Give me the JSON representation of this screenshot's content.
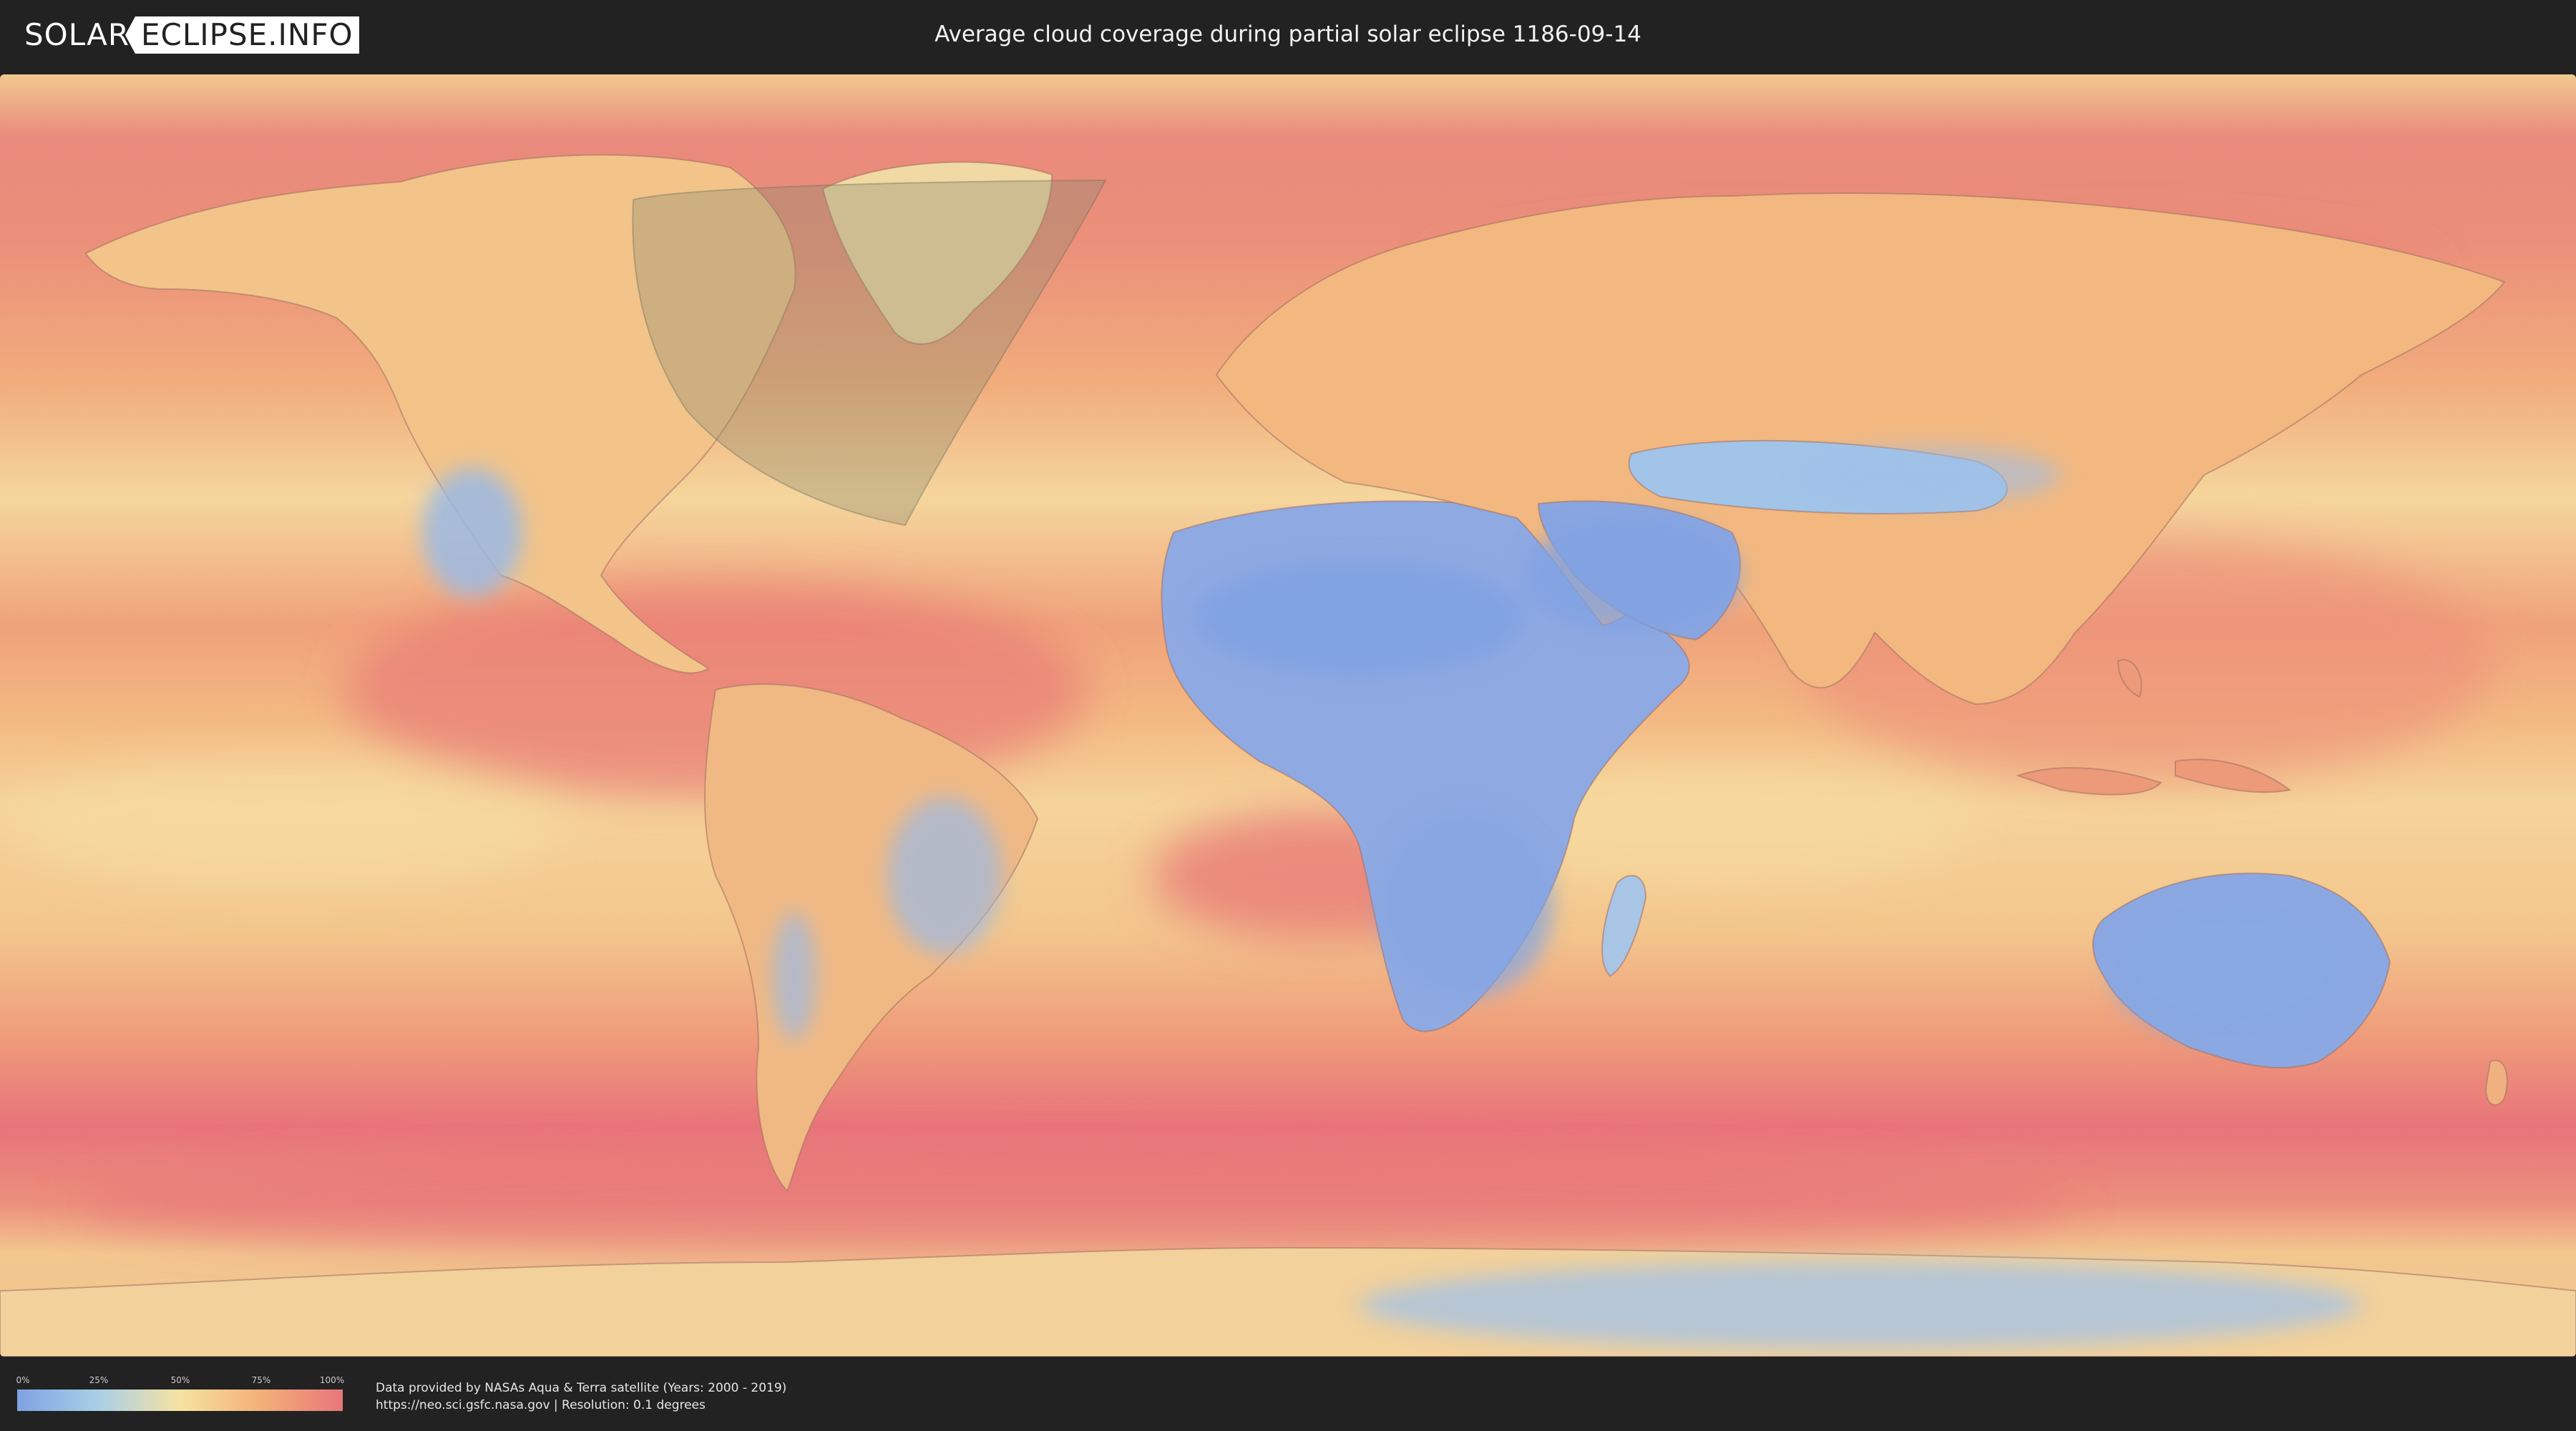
{
  "header": {
    "logo_left": "SOLAR",
    "logo_right": "ECLIPSE.INFO",
    "title": "Average cloud coverage during partial solar eclipse 1186-09-14"
  },
  "map": {
    "theme": "cloud coverage heatmap",
    "colors": {
      "clear": "#7fa3e3",
      "low": "#a9cfe6",
      "mid": "#f6e2a2",
      "high": "#f3b077",
      "overcast": "#e8767a",
      "eclipse_shade": "#8a8a6e"
    }
  },
  "legend": {
    "ticks": [
      "0%",
      "25%",
      "50%",
      "75%",
      "100%"
    ]
  },
  "footer": {
    "credit_line1": "Data provided by NASAs Aqua & Terra satellite (Years: 2000 - 2019)",
    "credit_line2": "https://neo.sci.gsfc.nasa.gov | Resolution: 0.1 degrees"
  }
}
